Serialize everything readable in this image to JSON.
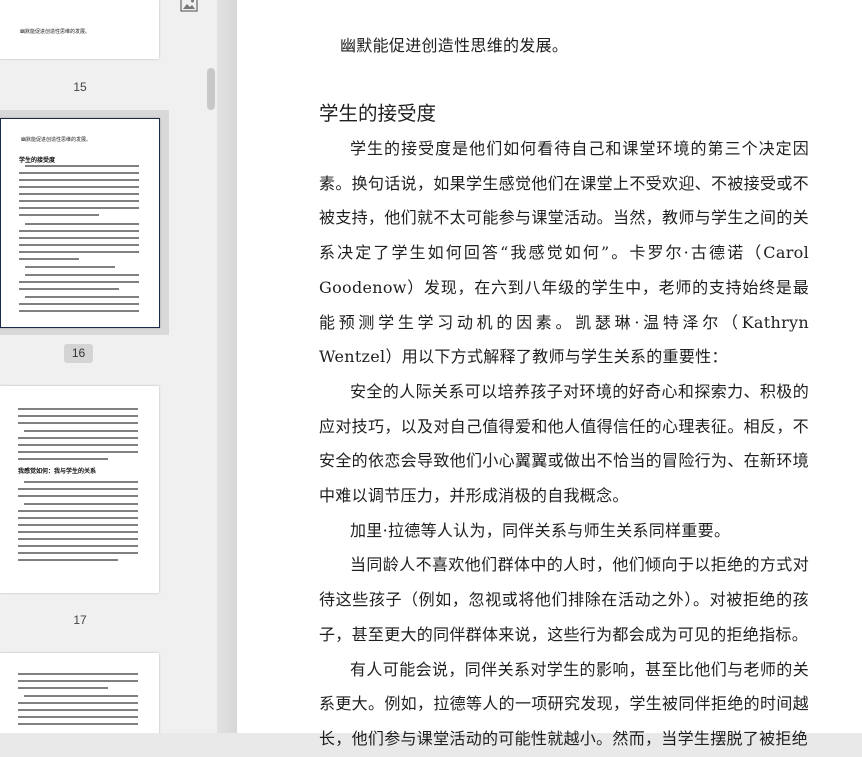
{
  "sidebar": {
    "thumbnails": [
      {
        "page_label": "15",
        "snippet": "幽默能促进创造性思维的发展。"
      },
      {
        "page_label": "16",
        "heading": "学生的接受度",
        "snippet": "幽默能促进创造性思维的发展。",
        "selected": true
      },
      {
        "page_label": "17",
        "heading": "我感觉如何：我与学生的关系"
      },
      {
        "page_label": "",
        "snippet": ""
      }
    ]
  },
  "document": {
    "first_line": "幽默能促进创造性思维的发展。",
    "section_title": "学生的接受度",
    "paragraphs": [
      "学生的接受度是他们如何看待自己和课堂环境的第三个决定因素。换句话说，如果学生感觉他们在课堂上不受欢迎、不被接受或不被支持，他们就不太可能参与课堂活动。当然，教师与学生之间的关系决定了学生如何回答“我感觉如何”。卡罗尔·古德诺（Carol Goodenow）发现，在六到八年级的学生中，老师的支持始终是最能预测学生学习动机的因素。凯瑟琳·温特泽尔（Kathryn Wentzel）用以下方式解释了教师与学生关系的重要性：",
      "安全的人际关系可以培养孩子对环境的好奇心和探索力、积极的应对技巧，以及对自己值得爱和他人值得信任的心理表征。相反，不安全的依恋会导致他们小心翼翼或做出不恰当的冒险行为、在新环境中难以调节压力，并形成消极的自我概念。",
      "加里·拉德等人认为，同伴关系与师生关系同样重要。",
      "当同龄人不喜欢他们群体中的人时，他们倾向于以拒绝的方式对待这些孩子（例如，忽视或将他们排除在活动之外）。对被拒绝的孩子，甚至更大的同伴群体来说，这些行为都会成为可见的拒绝指标。",
      "有人可能会说，同伴关系对学生的影响，甚至比他们与老师的关系更大。例如，拉德等人的一项研究发现，学生被同伴拒绝的时间越长，他们参与课堂活动的可能性就越小。然而，当学生摆脱了被拒绝"
    ]
  }
}
